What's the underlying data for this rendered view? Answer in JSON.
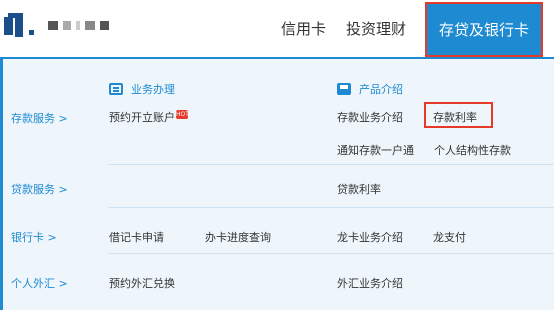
{
  "header": {
    "nav": {
      "credit_card": "信用卡",
      "invest": "投资理财",
      "deposit_bank_card": "存贷及银行卡"
    }
  },
  "panel": {
    "section_business": "业务办理",
    "section_products": "产品介绍",
    "rows": [
      {
        "category": "存款服务 >",
        "business": [
          "预约开立账户"
        ],
        "products": [
          "存款业务介绍",
          "存款利率",
          "通知存款一户通",
          "个人结构性存款"
        ]
      },
      {
        "category": "贷款服务 >",
        "business": [],
        "products": [
          "贷款利率"
        ]
      },
      {
        "category": "银行卡 >",
        "business": [
          "借记卡申请",
          "办卡进度查询"
        ],
        "products": [
          "龙卡业务介绍",
          "龙支付"
        ]
      },
      {
        "category": "个人外汇 >",
        "business": [
          "预约外汇兑换"
        ],
        "products": [
          "外汇业务介绍"
        ]
      }
    ]
  },
  "colors": {
    "accent_blue": "#1d8ad1",
    "highlight_red": "#e53a2a",
    "panel_bg": "#eef6fc"
  }
}
